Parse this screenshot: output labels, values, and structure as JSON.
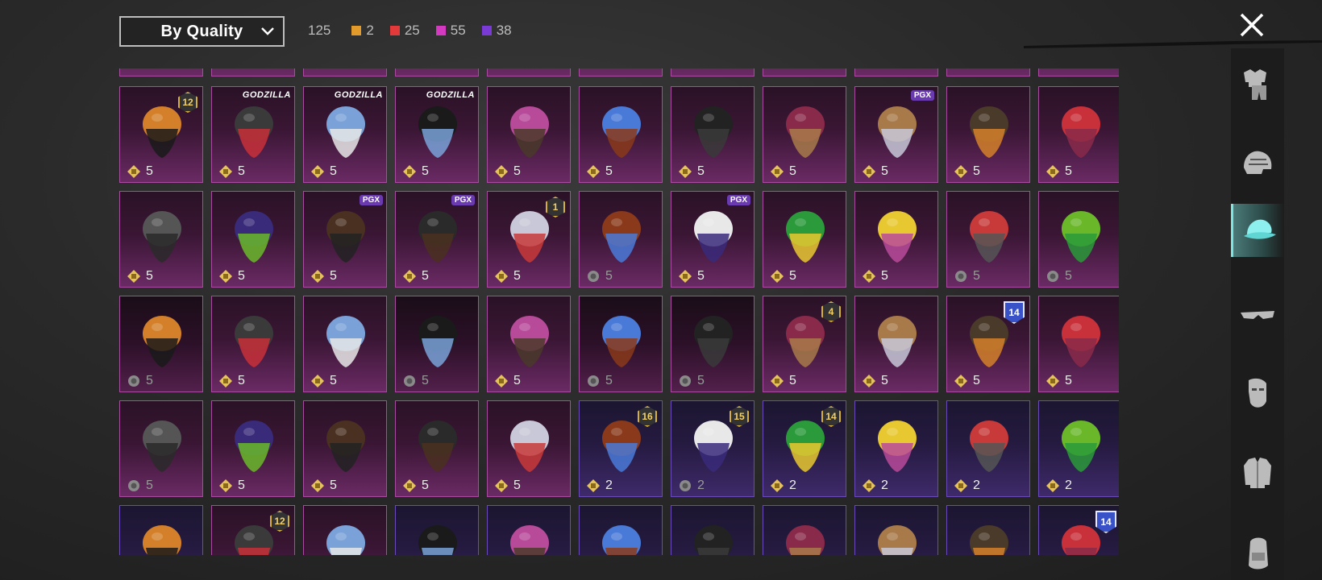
{
  "filter": {
    "sort_label": "By Quality"
  },
  "counts": {
    "total": "125",
    "qualities": [
      {
        "color": "#e29a2a",
        "value": "2"
      },
      {
        "color": "#e23a3a",
        "value": "25"
      },
      {
        "color": "#d43ac0",
        "value": "55"
      },
      {
        "color": "#7a3ad6",
        "value": "38"
      }
    ]
  },
  "categories": [
    "outfit-icon",
    "helmet-icon",
    "hat-icon",
    "glasses-icon",
    "mask-icon",
    "jacket-icon",
    "backpack-icon"
  ],
  "active_category": 2,
  "rows": [
    [
      {
        "name": "scarecrow-hair",
        "amount": "5",
        "badge": {
          "type": "level",
          "text": "12"
        }
      },
      {
        "name": "spiked-cap",
        "amount": "5",
        "badge": {
          "type": "brand",
          "text": "GODZILLA"
        }
      },
      {
        "name": "blue-feather-hair",
        "amount": "5",
        "badge": {
          "type": "brand",
          "text": "GODZILLA"
        }
      },
      {
        "name": "red-visor-hair",
        "amount": "5",
        "badge": {
          "type": "brand",
          "text": "GODZILLA"
        }
      },
      {
        "name": "purple-bob-hair",
        "amount": "5"
      },
      {
        "name": "blue-flame-hair",
        "amount": "5"
      },
      {
        "name": "black-hair",
        "amount": "5"
      },
      {
        "name": "pink-fluff-hair",
        "amount": "5"
      },
      {
        "name": "bear-mask",
        "amount": "5",
        "badge": {
          "type": "pill",
          "text": "PGX"
        }
      },
      {
        "name": "dark-feather",
        "amount": "5"
      },
      {
        "name": "red-cat-helmet",
        "amount": "5"
      }
    ],
    [
      {
        "name": "shark-head",
        "amount": "5"
      },
      {
        "name": "purple-helmet",
        "amount": "5"
      },
      {
        "name": "dread-hair",
        "amount": "5",
        "badge": {
          "type": "pill",
          "text": "PGX"
        }
      },
      {
        "name": "black-cat-mask",
        "amount": "5",
        "badge": {
          "type": "pill",
          "text": "PGX"
        }
      },
      {
        "name": "silver-twin-tails",
        "amount": "5",
        "badge": {
          "type": "level",
          "text": "1"
        }
      },
      {
        "name": "chomp-beanie",
        "amount": "5",
        "faded": true
      },
      {
        "name": "bunny-mask",
        "amount": "5",
        "badge": {
          "type": "pill",
          "text": "PGX"
        }
      },
      {
        "name": "green-cyber-helmet",
        "amount": "5"
      },
      {
        "name": "duck-mask",
        "amount": "5"
      },
      {
        "name": "clown-mask",
        "amount": "5",
        "faded": true
      },
      {
        "name": "green-monster-head",
        "amount": "5",
        "faded": true
      }
    ],
    [
      {
        "name": "black-top-hat",
        "amount": "5",
        "faded": true,
        "dark": true
      },
      {
        "name": "clown-face-hat",
        "amount": "5"
      },
      {
        "name": "golden-crown-helm",
        "amount": "5"
      },
      {
        "name": "gas-mask-helmet",
        "amount": "5",
        "faded": true,
        "dark": true
      },
      {
        "name": "brass-pith-helmet",
        "amount": "5"
      },
      {
        "name": "grey-wolf-hair",
        "amount": "5",
        "faded": true,
        "dark": true
      },
      {
        "name": "pink-witch-hat",
        "amount": "5",
        "faded": true,
        "dark": true
      },
      {
        "name": "tribal-mask",
        "amount": "5",
        "badge": {
          "type": "level",
          "text": "4"
        }
      },
      {
        "name": "silver-hair",
        "amount": "5"
      },
      {
        "name": "officer-cap",
        "amount": "5",
        "badge": {
          "type": "season",
          "text": "14"
        }
      },
      {
        "name": "sheep-head",
        "amount": "5"
      }
    ],
    [
      {
        "name": "red-crab-hat",
        "amount": "5",
        "faded": true
      },
      {
        "name": "blue-racing-helmet",
        "amount": "5"
      },
      {
        "name": "white-bucket-hat",
        "amount": "5"
      },
      {
        "name": "white-bucket-hat-2",
        "amount": "5"
      },
      {
        "name": "bunny-ears-headband",
        "amount": "5"
      },
      {
        "name": "striped-beanie",
        "amount": "2",
        "purple": true,
        "badge": {
          "type": "level",
          "text": "16"
        }
      },
      {
        "name": "pumpkin-hood",
        "amount": "2",
        "purple": true,
        "faded": true,
        "badge": {
          "type": "level",
          "text": "15"
        }
      },
      {
        "name": "cat-ear-cap-hair",
        "amount": "2",
        "purple": true,
        "badge": {
          "type": "level",
          "text": "14"
        }
      },
      {
        "name": "red-hair-headphones",
        "amount": "2",
        "purple": true
      },
      {
        "name": "pink-braid",
        "amount": "2",
        "purple": true
      },
      {
        "name": "mustard-beret",
        "amount": "2",
        "purple": true
      }
    ],
    [
      {
        "name": "brown-hair",
        "amount": "",
        "purple": true
      },
      {
        "name": "bunny-beanie",
        "amount": "",
        "badge": {
          "type": "level",
          "text": "12"
        }
      },
      {
        "name": "pink-cat-beanie",
        "amount": ""
      },
      {
        "name": "horns",
        "amount": "",
        "purple": true
      },
      {
        "name": "goggles-hair",
        "amount": "",
        "purple": true
      },
      {
        "name": "cyber-cap",
        "amount": "",
        "purple": true
      },
      {
        "name": "sun-hat",
        "amount": "",
        "purple": true
      },
      {
        "name": "orange-ears",
        "amount": "",
        "purple": true
      },
      {
        "name": "red-spiky-hair",
        "amount": "",
        "purple": true
      },
      {
        "name": "steampunk-hat",
        "amount": "",
        "purple": true
      },
      {
        "name": "police-cap",
        "amount": "",
        "purple": true,
        "badge": {
          "type": "season",
          "text": "14"
        }
      }
    ]
  ]
}
